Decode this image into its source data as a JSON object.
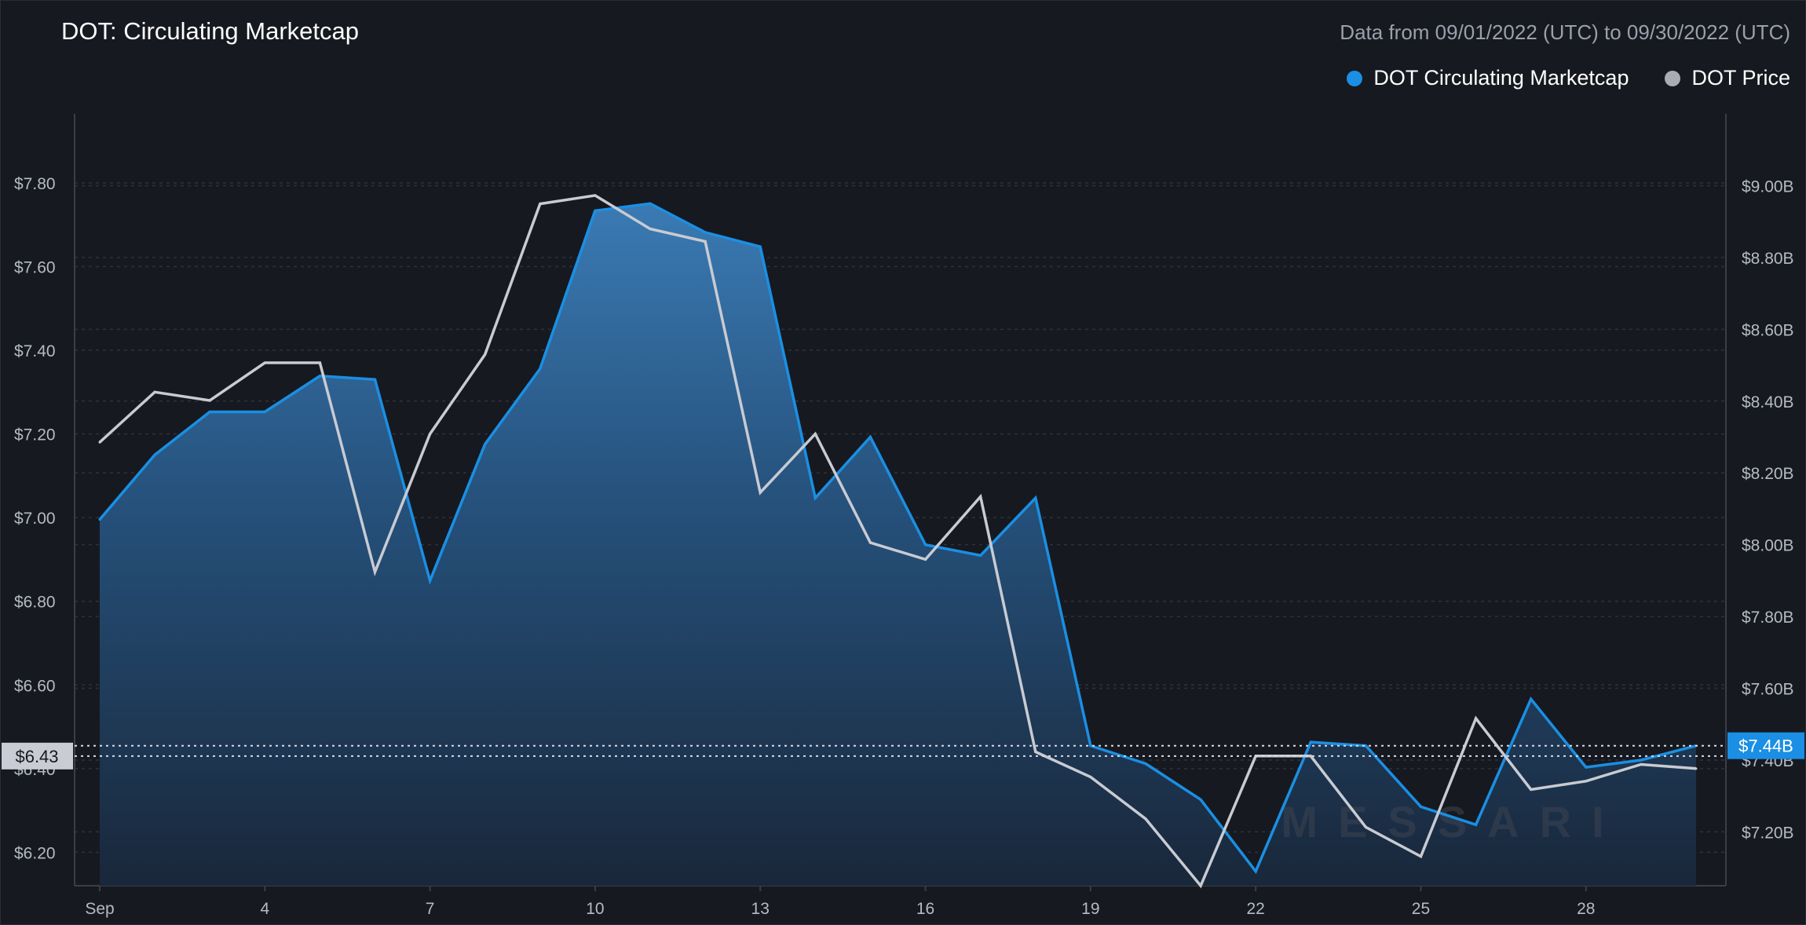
{
  "header": {
    "title": "DOT: Circulating Marketcap",
    "date_range": "Data from 09/01/2022 (UTC) to 09/30/2022 (UTC)"
  },
  "legend": [
    {
      "label": "DOT Circulating Marketcap",
      "color": "#1a8fe3"
    },
    {
      "label": "DOT Price",
      "color": "#a9acb5"
    }
  ],
  "watermark": "MESSARI",
  "chart_data": {
    "type": "line",
    "x": [
      1,
      2,
      3,
      4,
      5,
      6,
      7,
      8,
      9,
      10,
      11,
      12,
      13,
      14,
      15,
      16,
      17,
      18,
      19,
      20,
      21,
      22,
      23,
      24,
      25,
      26,
      27,
      28,
      29,
      30
    ],
    "x_ticks": [
      {
        "value": 1,
        "label": "Sep"
      },
      {
        "value": 4,
        "label": "4"
      },
      {
        "value": 7,
        "label": "7"
      },
      {
        "value": 10,
        "label": "10"
      },
      {
        "value": 13,
        "label": "13"
      },
      {
        "value": 16,
        "label": "16"
      },
      {
        "value": 19,
        "label": "19"
      },
      {
        "value": 22,
        "label": "22"
      },
      {
        "value": 25,
        "label": "25"
      },
      {
        "value": 28,
        "label": "28"
      }
    ],
    "left_axis": {
      "ticks": [
        "$6.20",
        "$6.40",
        "$6.60",
        "$6.80",
        "$7.00",
        "$7.20",
        "$7.40",
        "$7.60",
        "$7.80"
      ],
      "tick_values": [
        6.2,
        6.4,
        6.6,
        6.8,
        7.0,
        7.2,
        7.4,
        7.6,
        7.8
      ],
      "ylim": [
        6.12,
        7.965
      ]
    },
    "right_axis": {
      "ticks": [
        "$7.20B",
        "$7.40B",
        "$7.60B",
        "$7.80B",
        "$8.00B",
        "$8.20B",
        "$8.40B",
        "$8.60B",
        "$8.80B",
        "$9.00B"
      ],
      "tick_values": [
        7.2,
        7.4,
        7.6,
        7.8,
        8.0,
        8.2,
        8.4,
        8.6,
        8.8,
        9.0
      ],
      "ylim": [
        7.05,
        9.2
      ]
    },
    "series": [
      {
        "name": "DOT Circulating Marketcap",
        "axis": "right",
        "color": "#1a8fe3",
        "values": [
          8.07,
          8.25,
          8.37,
          8.37,
          8.47,
          8.46,
          7.9,
          8.28,
          8.49,
          8.93,
          8.95,
          8.87,
          8.83,
          8.13,
          8.3,
          8.0,
          7.97,
          8.13,
          7.44,
          7.39,
          7.29,
          7.09,
          7.45,
          7.44,
          7.27,
          7.22,
          7.57,
          7.38,
          7.4,
          7.44
        ]
      },
      {
        "name": "DOT Price",
        "axis": "left",
        "color": "#a9acb5",
        "values": [
          7.18,
          7.3,
          7.28,
          7.37,
          7.37,
          6.87,
          7.2,
          7.39,
          7.75,
          7.77,
          7.69,
          7.66,
          7.06,
          7.2,
          6.94,
          6.9,
          7.05,
          6.44,
          6.38,
          6.28,
          6.12,
          6.43,
          6.43,
          6.26,
          6.19,
          6.52,
          6.35,
          6.37,
          6.41,
          6.4
        ]
      }
    ],
    "markers": {
      "left_current": "$6.43",
      "left_current_value": 6.43,
      "right_current": "$7.44B",
      "right_current_value": 7.44
    },
    "grid": true
  }
}
